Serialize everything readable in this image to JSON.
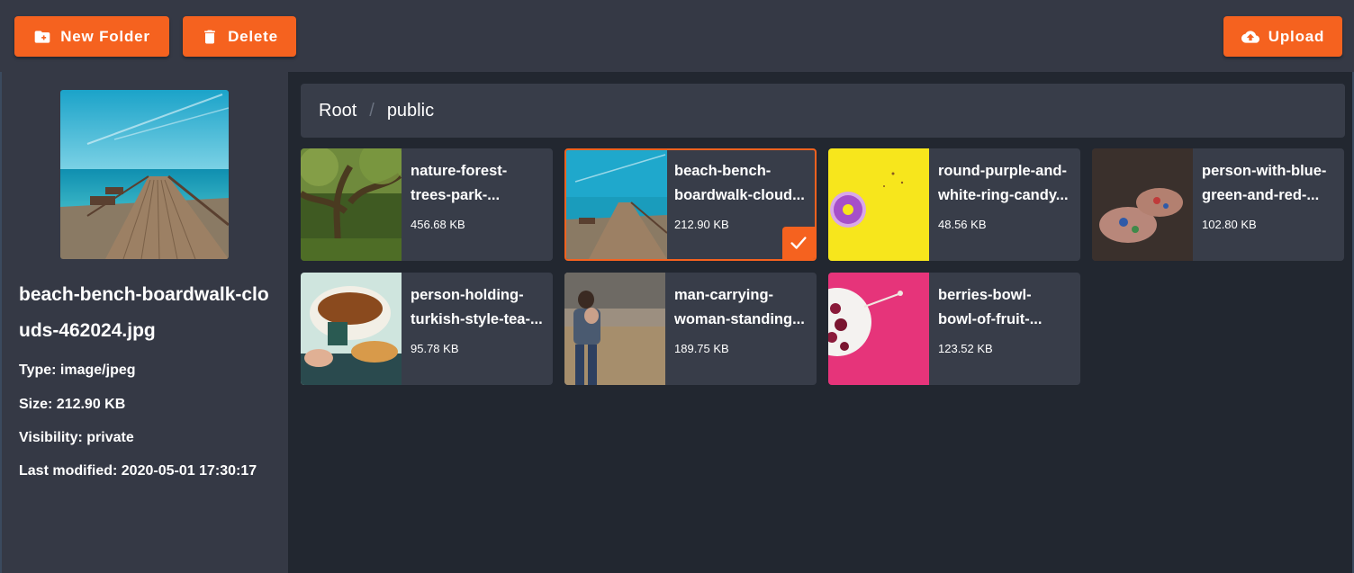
{
  "toolbar": {
    "new_folder_label": "New Folder",
    "delete_label": "Delete",
    "upload_label": "Upload"
  },
  "sidebar": {
    "title": "beach-bench-boardwalk-clouds-462024.jpg",
    "type": "Type: image/jpeg",
    "size": "Size: 212.90 KB",
    "visibility": "Visibility: private",
    "modified": "Last modified: 2020-05-01 17:30:17"
  },
  "breadcrumb": {
    "root": "Root",
    "separator": "/",
    "current": "public"
  },
  "files": [
    {
      "line1": "nature-forest-",
      "line2": "trees-park-...",
      "size": "456.68 KB",
      "thumb": "forest-trees-image"
    },
    {
      "line1": "beach-bench-",
      "line2": "boardwalk-cloud...",
      "size": "212.90 KB",
      "thumb": "beach-boardwalk-image",
      "selected": true
    },
    {
      "line1": "round-purple-and-",
      "line2": "white-ring-candy...",
      "size": "48.56 KB",
      "thumb": "purple-donut-image"
    },
    {
      "line1": "person-with-blue-",
      "line2": "green-and-red-...",
      "size": "102.80 KB",
      "thumb": "painted-hands-image"
    },
    {
      "line1": "person-holding-",
      "line2": "turkish-style-tea-...",
      "size": "95.78 KB",
      "thumb": "tea-cup-image"
    },
    {
      "line1": "man-carrying-",
      "line2": "woman-standing...",
      "size": "189.75 KB",
      "thumb": "couple-field-image"
    },
    {
      "line1": "berries-bowl-",
      "line2": "bowl-of-fruit-...",
      "size": "123.52 KB",
      "thumb": "berries-bowl-image"
    }
  ],
  "colors": {
    "accent": "#f5621f",
    "toolbar_bg": "#353945",
    "page_bg": "#222730",
    "card_bg": "#383d49"
  },
  "icons": {
    "new_folder": "folder-plus-icon",
    "delete": "trash-icon",
    "upload": "cloud-upload-icon",
    "selected": "checkmark-icon"
  }
}
